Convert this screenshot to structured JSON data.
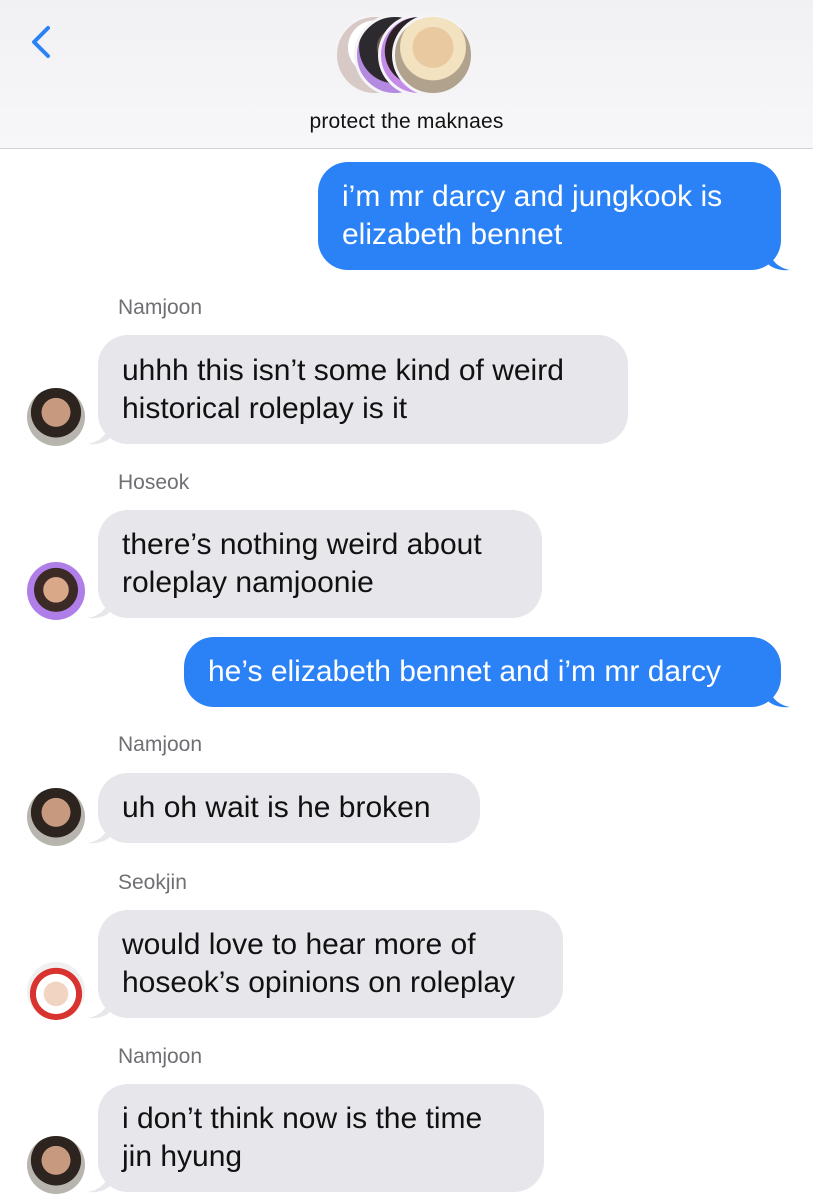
{
  "header": {
    "group_name": "protect the maknaes",
    "back_icon": "chevron-left-icon",
    "accent_color": "#2b82f6"
  },
  "messages": [
    {
      "direction": "outgoing",
      "lines": [
        "i’m mr darcy and jungkook is",
        "elizabeth bennet"
      ]
    },
    {
      "direction": "incoming",
      "sender": "Namjoon",
      "lines": [
        "uhhh this isn’t some kind of weird",
        "historical roleplay is it"
      ]
    },
    {
      "direction": "incoming",
      "sender": "Hoseok",
      "lines": [
        "there’s nothing weird about",
        "roleplay namjoonie"
      ]
    },
    {
      "direction": "outgoing",
      "lines": [
        "he’s elizabeth bennet and i’m mr darcy"
      ]
    },
    {
      "direction": "incoming",
      "sender": "Namjoon",
      "lines": [
        "uh oh wait is he broken"
      ]
    },
    {
      "direction": "incoming",
      "sender": "Seokjin",
      "lines": [
        "would love to hear more of",
        "hoseok’s opinions on roleplay"
      ]
    },
    {
      "direction": "incoming",
      "sender": "Namjoon",
      "lines": [
        "i don’t think now is the time",
        "jin hyung"
      ]
    }
  ]
}
